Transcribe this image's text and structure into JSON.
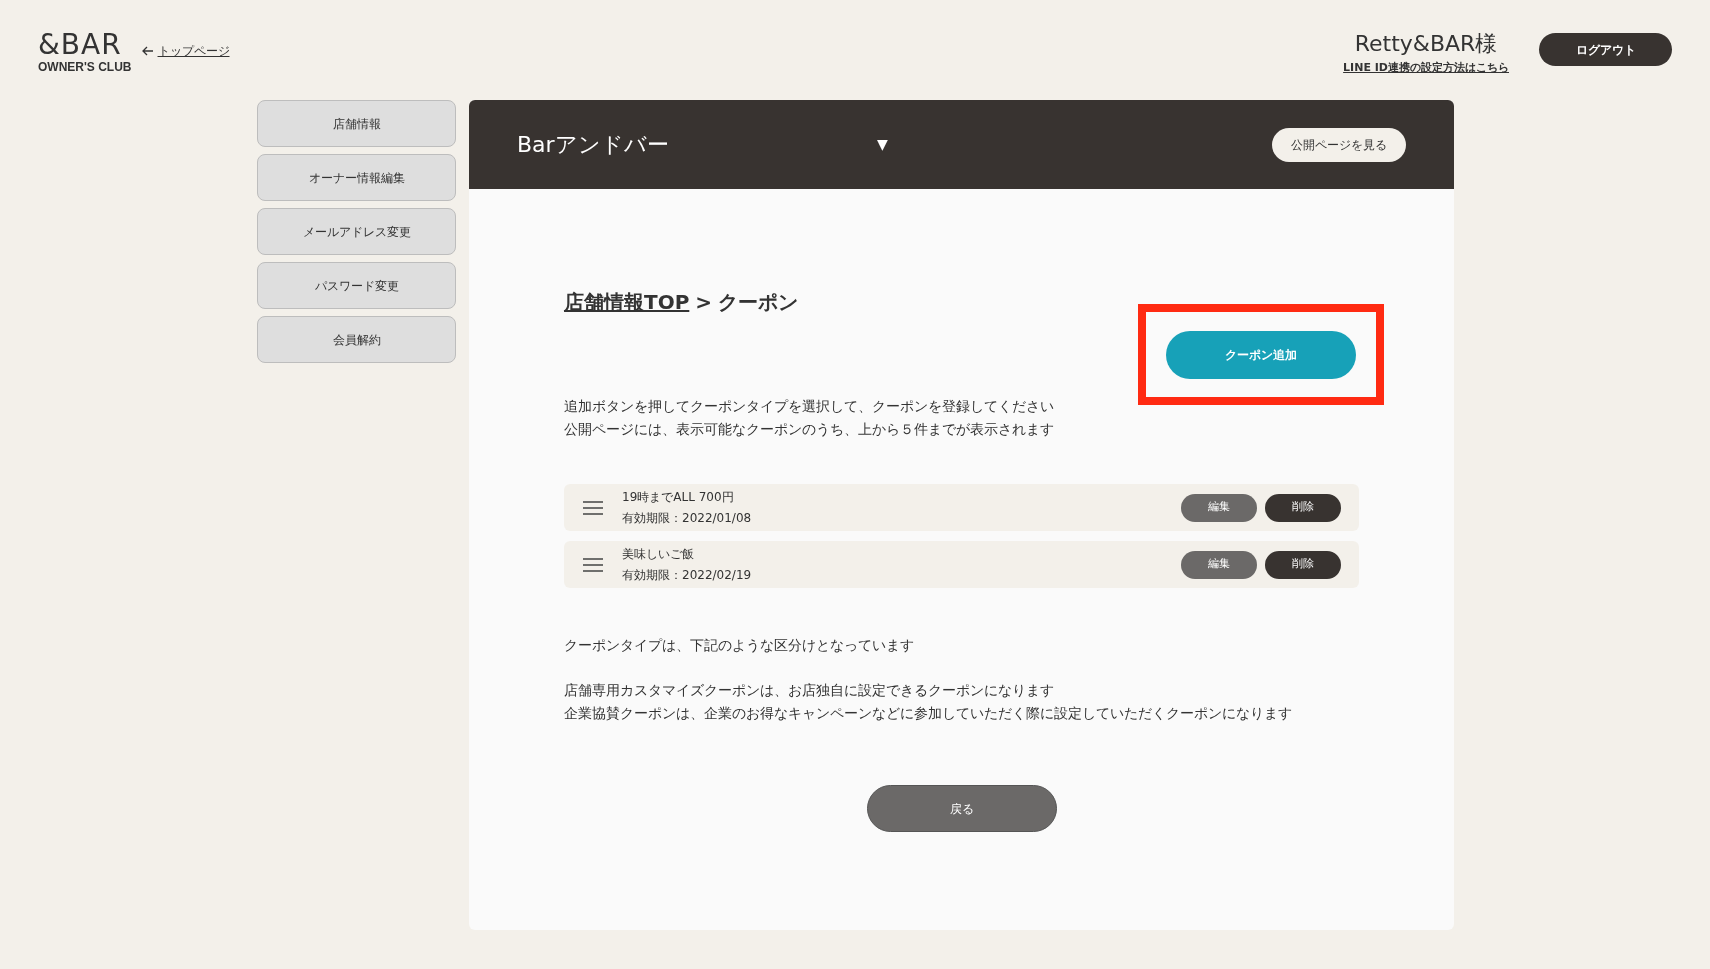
{
  "header": {
    "logo_top": "&BAR",
    "logo_bottom": "OWNER'S CLUB",
    "back_link": "トップページ",
    "user_name": "Retty&BAR様",
    "line_link": "LINE ID連携の設定方法はこちら",
    "logout": "ログアウト"
  },
  "sidebar": {
    "items": [
      {
        "label": "店舗情報"
      },
      {
        "label": "オーナー情報編集"
      },
      {
        "label": "メールアドレス変更"
      },
      {
        "label": "パスワード変更"
      },
      {
        "label": "会員解約"
      }
    ]
  },
  "panel": {
    "store_name": "Barアンドバー",
    "dropdown_arrow": "▼",
    "public_button": "公開ページを見る"
  },
  "breadcrumb": {
    "link": "店舗情報TOP",
    "separator": ">",
    "current": "クーポン"
  },
  "add_button": {
    "label": "クーポン追加",
    "highlighted": true
  },
  "intro": [
    "追加ボタンを押してクーポンタイプを選択して、クーポンを登録してください",
    "公開ページには、表示可能なクーポンのうち、上から５件までが表示されます"
  ],
  "coupons": [
    {
      "title": "19時までALL 700円",
      "expiry": "有効期限：2022/01/08",
      "edit": "編集",
      "delete": "削除"
    },
    {
      "title": "美味しいご飯",
      "expiry": "有効期限：2022/02/19",
      "edit": "編集",
      "delete": "削除"
    }
  ],
  "notes": [
    [
      "クーポンタイプは、下記のような区分けとなっています"
    ],
    [
      "店舗専用カスタマイズクーポンは、お店独自に設定できるクーポンになります",
      "企業協賛クーポンは、企業のお得なキャンペーンなどに参加していただく際に設定していただくクーポンになります"
    ]
  ],
  "back_button": "戻る"
}
